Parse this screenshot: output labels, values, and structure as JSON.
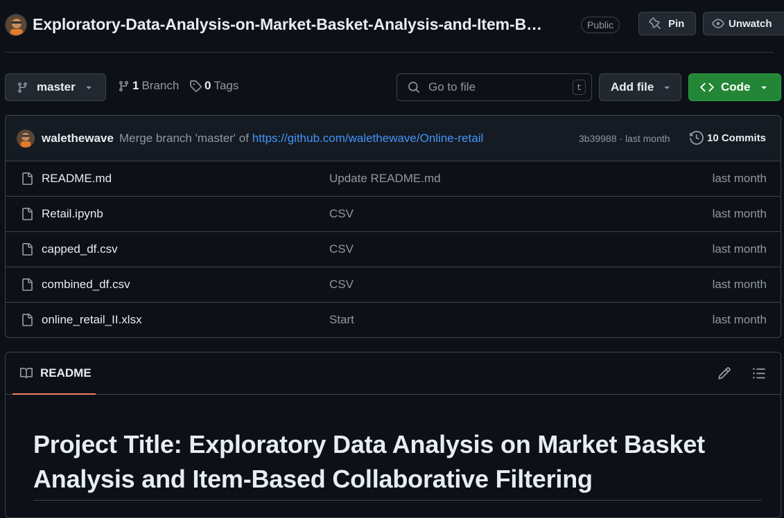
{
  "header": {
    "repo_title": "Exploratory-Data-Analysis-on-Market-Basket-Analysis-and-Item-B…",
    "visibility": "Public",
    "pin_label": "Pin",
    "unwatch_label": "Unwatch"
  },
  "toolbar": {
    "branch": "master",
    "branches_count": "1",
    "branches_label": "Branch",
    "tags_count": "0",
    "tags_label": "Tags",
    "search_placeholder": "Go to file",
    "search_shortcut": "t",
    "add_file_label": "Add file",
    "code_label": "Code"
  },
  "latest_commit": {
    "author": "walethewave",
    "message_prefix": "Merge branch 'master' of ",
    "message_link": "https://github.com/walethewave/Online-retail",
    "meta": "3b39988 · last month",
    "commits_label": "10 Commits"
  },
  "files": [
    {
      "name": "README.md",
      "message": "Update README.md",
      "date": "last month"
    },
    {
      "name": "Retail.ipynb",
      "message": "CSV",
      "date": "last month"
    },
    {
      "name": "capped_df.csv",
      "message": "CSV",
      "date": "last month"
    },
    {
      "name": "combined_df.csv",
      "message": "CSV",
      "date": "last month"
    },
    {
      "name": "online_retail_II.xlsx",
      "message": "Start",
      "date": "last month"
    }
  ],
  "readme": {
    "tab_label": "README",
    "title": "Project Title: Exploratory Data Analysis on Market Basket Analysis and Item-Based Collaborative Filtering"
  },
  "icons": {
    "branch": "git-branch-icon",
    "tag": "tag-icon",
    "search": "search-icon",
    "history": "history-icon",
    "file": "file-icon",
    "book": "book-icon",
    "pencil": "pencil-icon",
    "list": "list-unordered-icon",
    "pin": "pin-icon",
    "eye": "eye-icon"
  },
  "colors": {
    "background": "#0d1117",
    "accent_green": "#238636",
    "link_blue": "#4493f8",
    "muted_text": "#9198a1",
    "tab_underline": "#f78166"
  }
}
